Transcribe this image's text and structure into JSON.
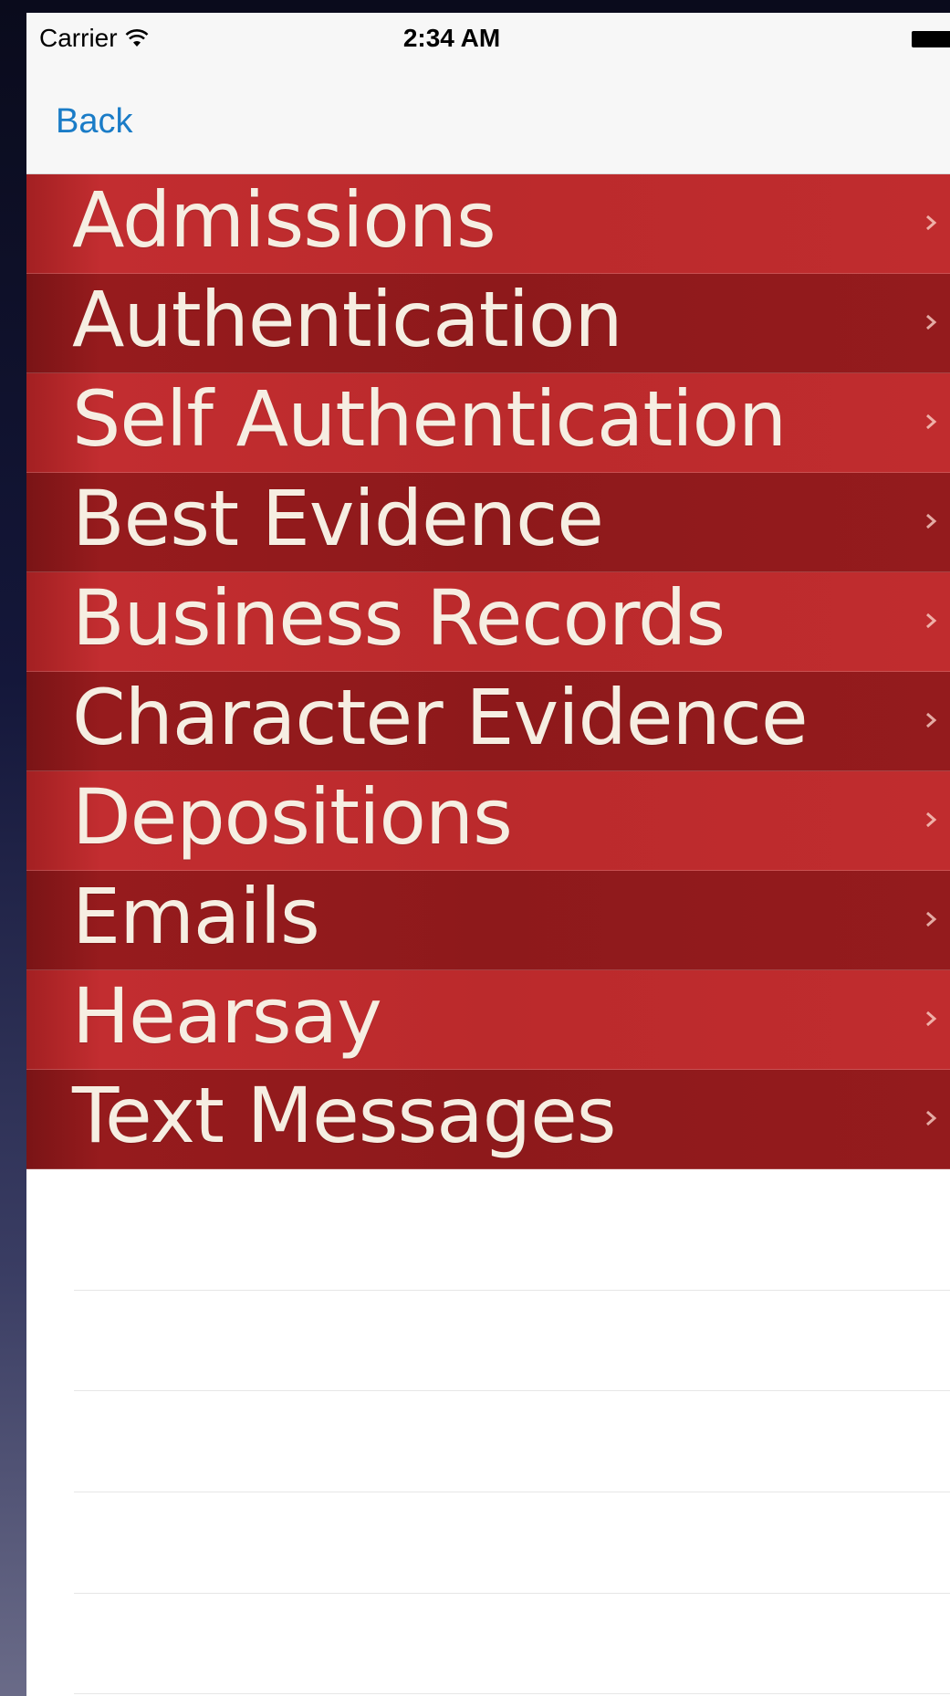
{
  "status_bar": {
    "carrier": "Carrier",
    "time": "2:34 AM",
    "icons": [
      "wifi-icon",
      "battery-icon"
    ]
  },
  "nav_bar": {
    "back_label": "Back",
    "back_color": "#1a7cc7"
  },
  "list": {
    "items": [
      {
        "label": "Admissions",
        "icon": "chevron-right-icon"
      },
      {
        "label": "Authentication",
        "icon": "chevron-right-icon"
      },
      {
        "label": "Self Authentication",
        "icon": "chevron-right-icon"
      },
      {
        "label": "Best Evidence",
        "icon": "chevron-right-icon"
      },
      {
        "label": "Business Records",
        "icon": "chevron-right-icon"
      },
      {
        "label": "Character Evidence",
        "icon": "chevron-right-icon"
      },
      {
        "label": "Depositions",
        "icon": "chevron-right-icon"
      },
      {
        "label": "Emails",
        "icon": "chevron-right-icon"
      },
      {
        "label": "Hearsay",
        "icon": "chevron-right-icon"
      },
      {
        "label": "Text Messages",
        "icon": "chevron-right-icon"
      }
    ],
    "row_colors": {
      "light": "#bb2a2c",
      "dark": "#8e191b",
      "text": "#f6eee2"
    }
  }
}
